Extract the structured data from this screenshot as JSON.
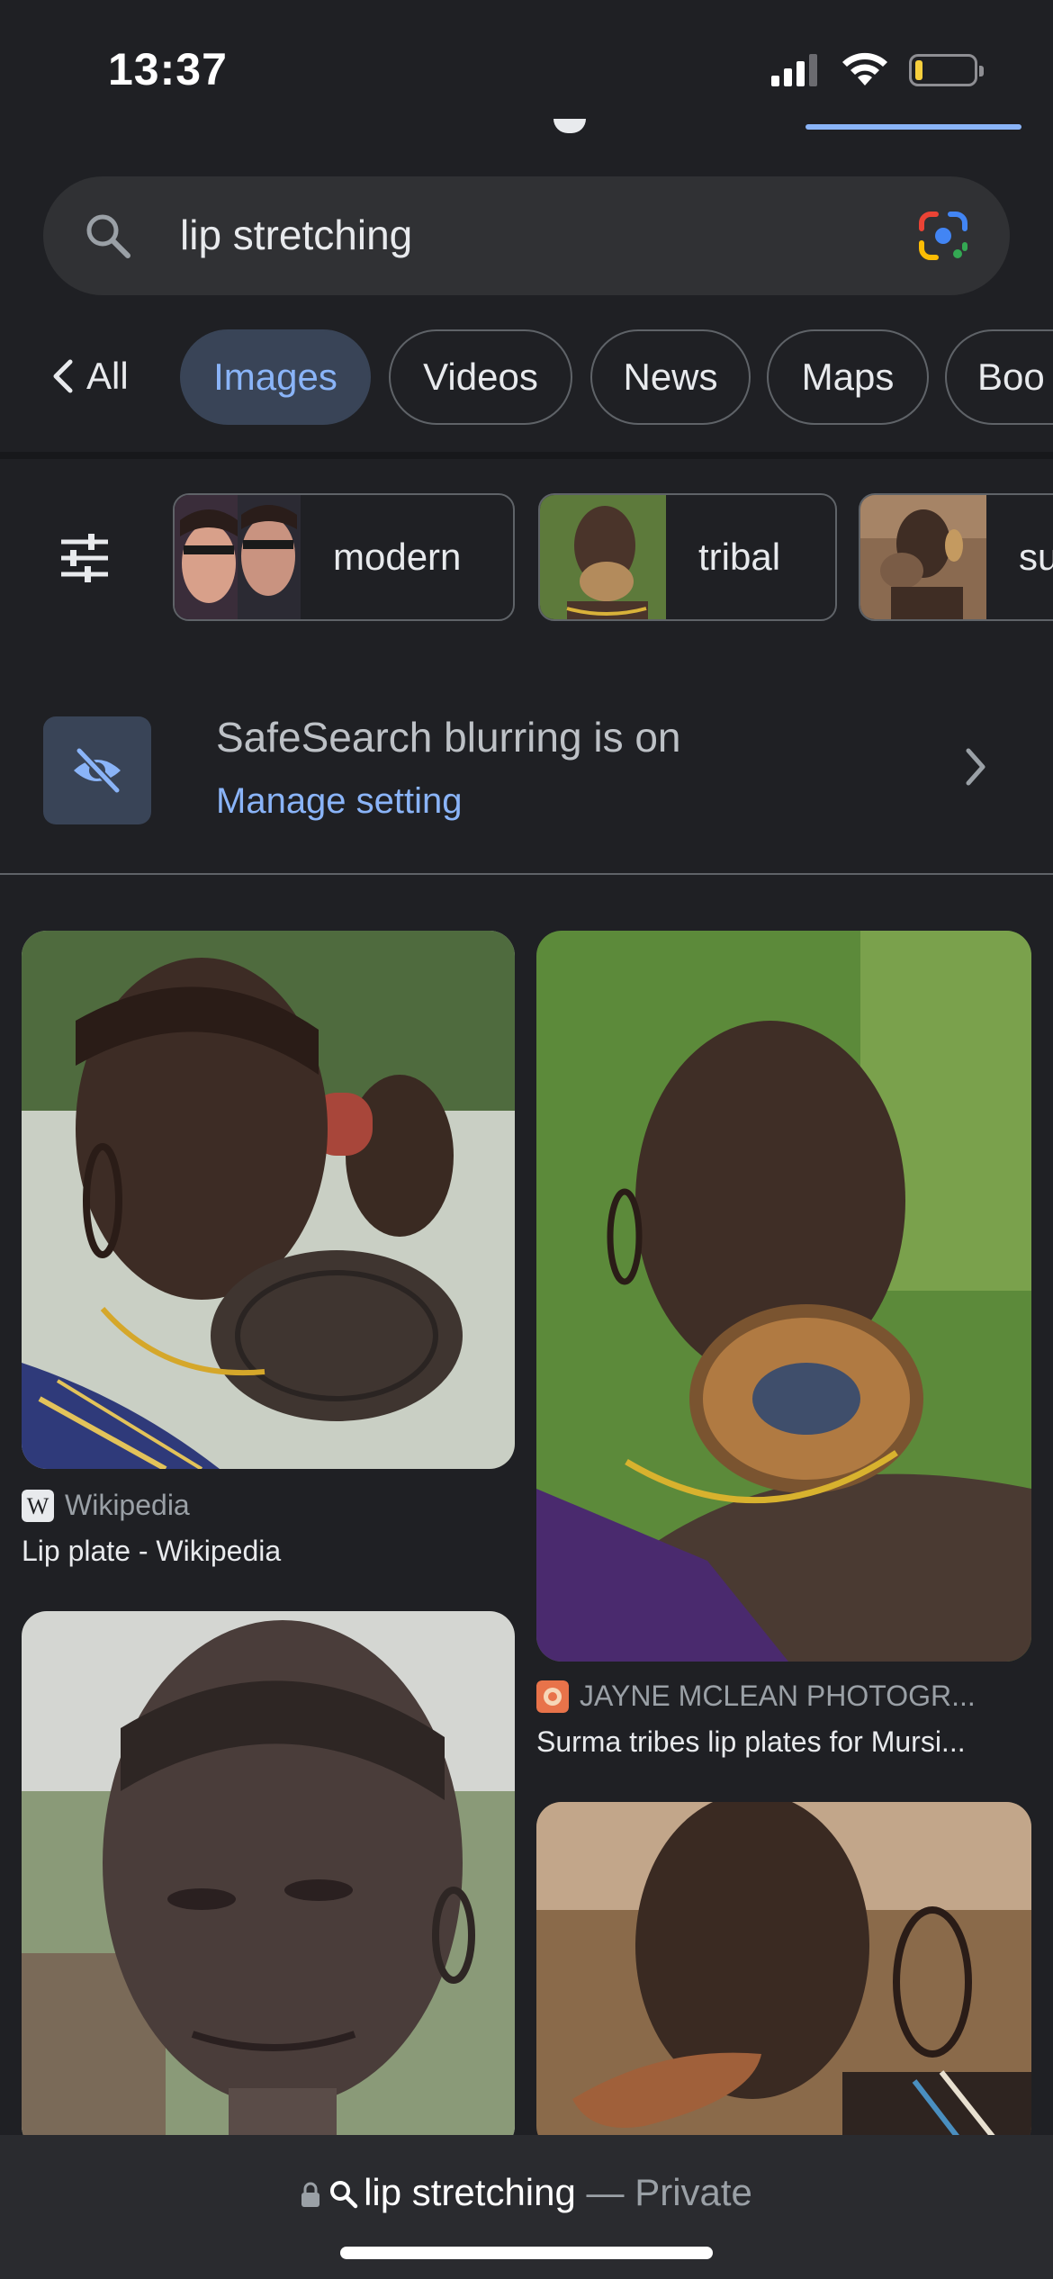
{
  "status_bar": {
    "time": "13:37",
    "battery_level": 0.12
  },
  "search": {
    "query": "lip stretching",
    "lens_icon": "google-lens-icon"
  },
  "tabs": {
    "all_label": "All",
    "items": [
      "Images",
      "Videos",
      "News",
      "Maps",
      "Boo"
    ],
    "active": "Images"
  },
  "chips": [
    {
      "label": "modern"
    },
    {
      "label": "tribal"
    },
    {
      "label": "su"
    }
  ],
  "safesearch": {
    "title": "SafeSearch blurring is on",
    "link": "Manage setting"
  },
  "results": [
    {
      "source": "Wikipedia",
      "title": "Lip plate - Wikipedia"
    },
    {
      "source": "JAYNE MCLEAN PHOTOGR...",
      "title": "Surma tribes lip plates for Mursi..."
    }
  ],
  "bottom_bar": {
    "query": "lip stretching",
    "separator": " — ",
    "mode": "Private"
  },
  "colors": {
    "background": "#1f2024",
    "accent": "#8ab4f8",
    "chip_active_bg": "#394457"
  }
}
